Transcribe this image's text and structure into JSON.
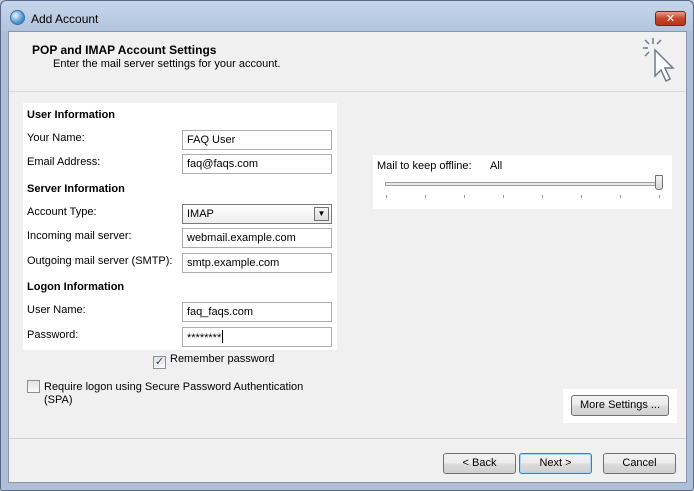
{
  "window": {
    "title": "Add Account",
    "close_label": "✕"
  },
  "header": {
    "title": "POP and IMAP Account Settings",
    "subtitle": "Enter the mail server settings for your account."
  },
  "user_info": {
    "heading": "User Information",
    "your_name_label": "Your Name:",
    "your_name_value": "FAQ User",
    "email_label": "Email Address:",
    "email_value": "faq@faqs.com"
  },
  "server_info": {
    "heading": "Server Information",
    "account_type_label": "Account Type:",
    "account_type_value": "IMAP",
    "incoming_label": "Incoming mail server:",
    "incoming_value": "webmail.example.com",
    "outgoing_label": "Outgoing mail server (SMTP):",
    "outgoing_value": "smtp.example.com"
  },
  "logon_info": {
    "heading": "Logon Information",
    "user_name_label": "User Name:",
    "user_name_value": "faq_faqs.com",
    "password_label": "Password:",
    "password_value": "********",
    "remember_label": "Remember password",
    "remember_checked": true,
    "spa_label_line1": "Require logon using Secure Password Authentication",
    "spa_label_line2": "(SPA)",
    "spa_checked": false
  },
  "offline": {
    "label": "Mail to keep offline:",
    "value": "All",
    "slider_fraction": 1.0
  },
  "buttons": {
    "more_settings": "More Settings ...",
    "back": "< Back",
    "next": "Next >",
    "cancel": "Cancel"
  }
}
